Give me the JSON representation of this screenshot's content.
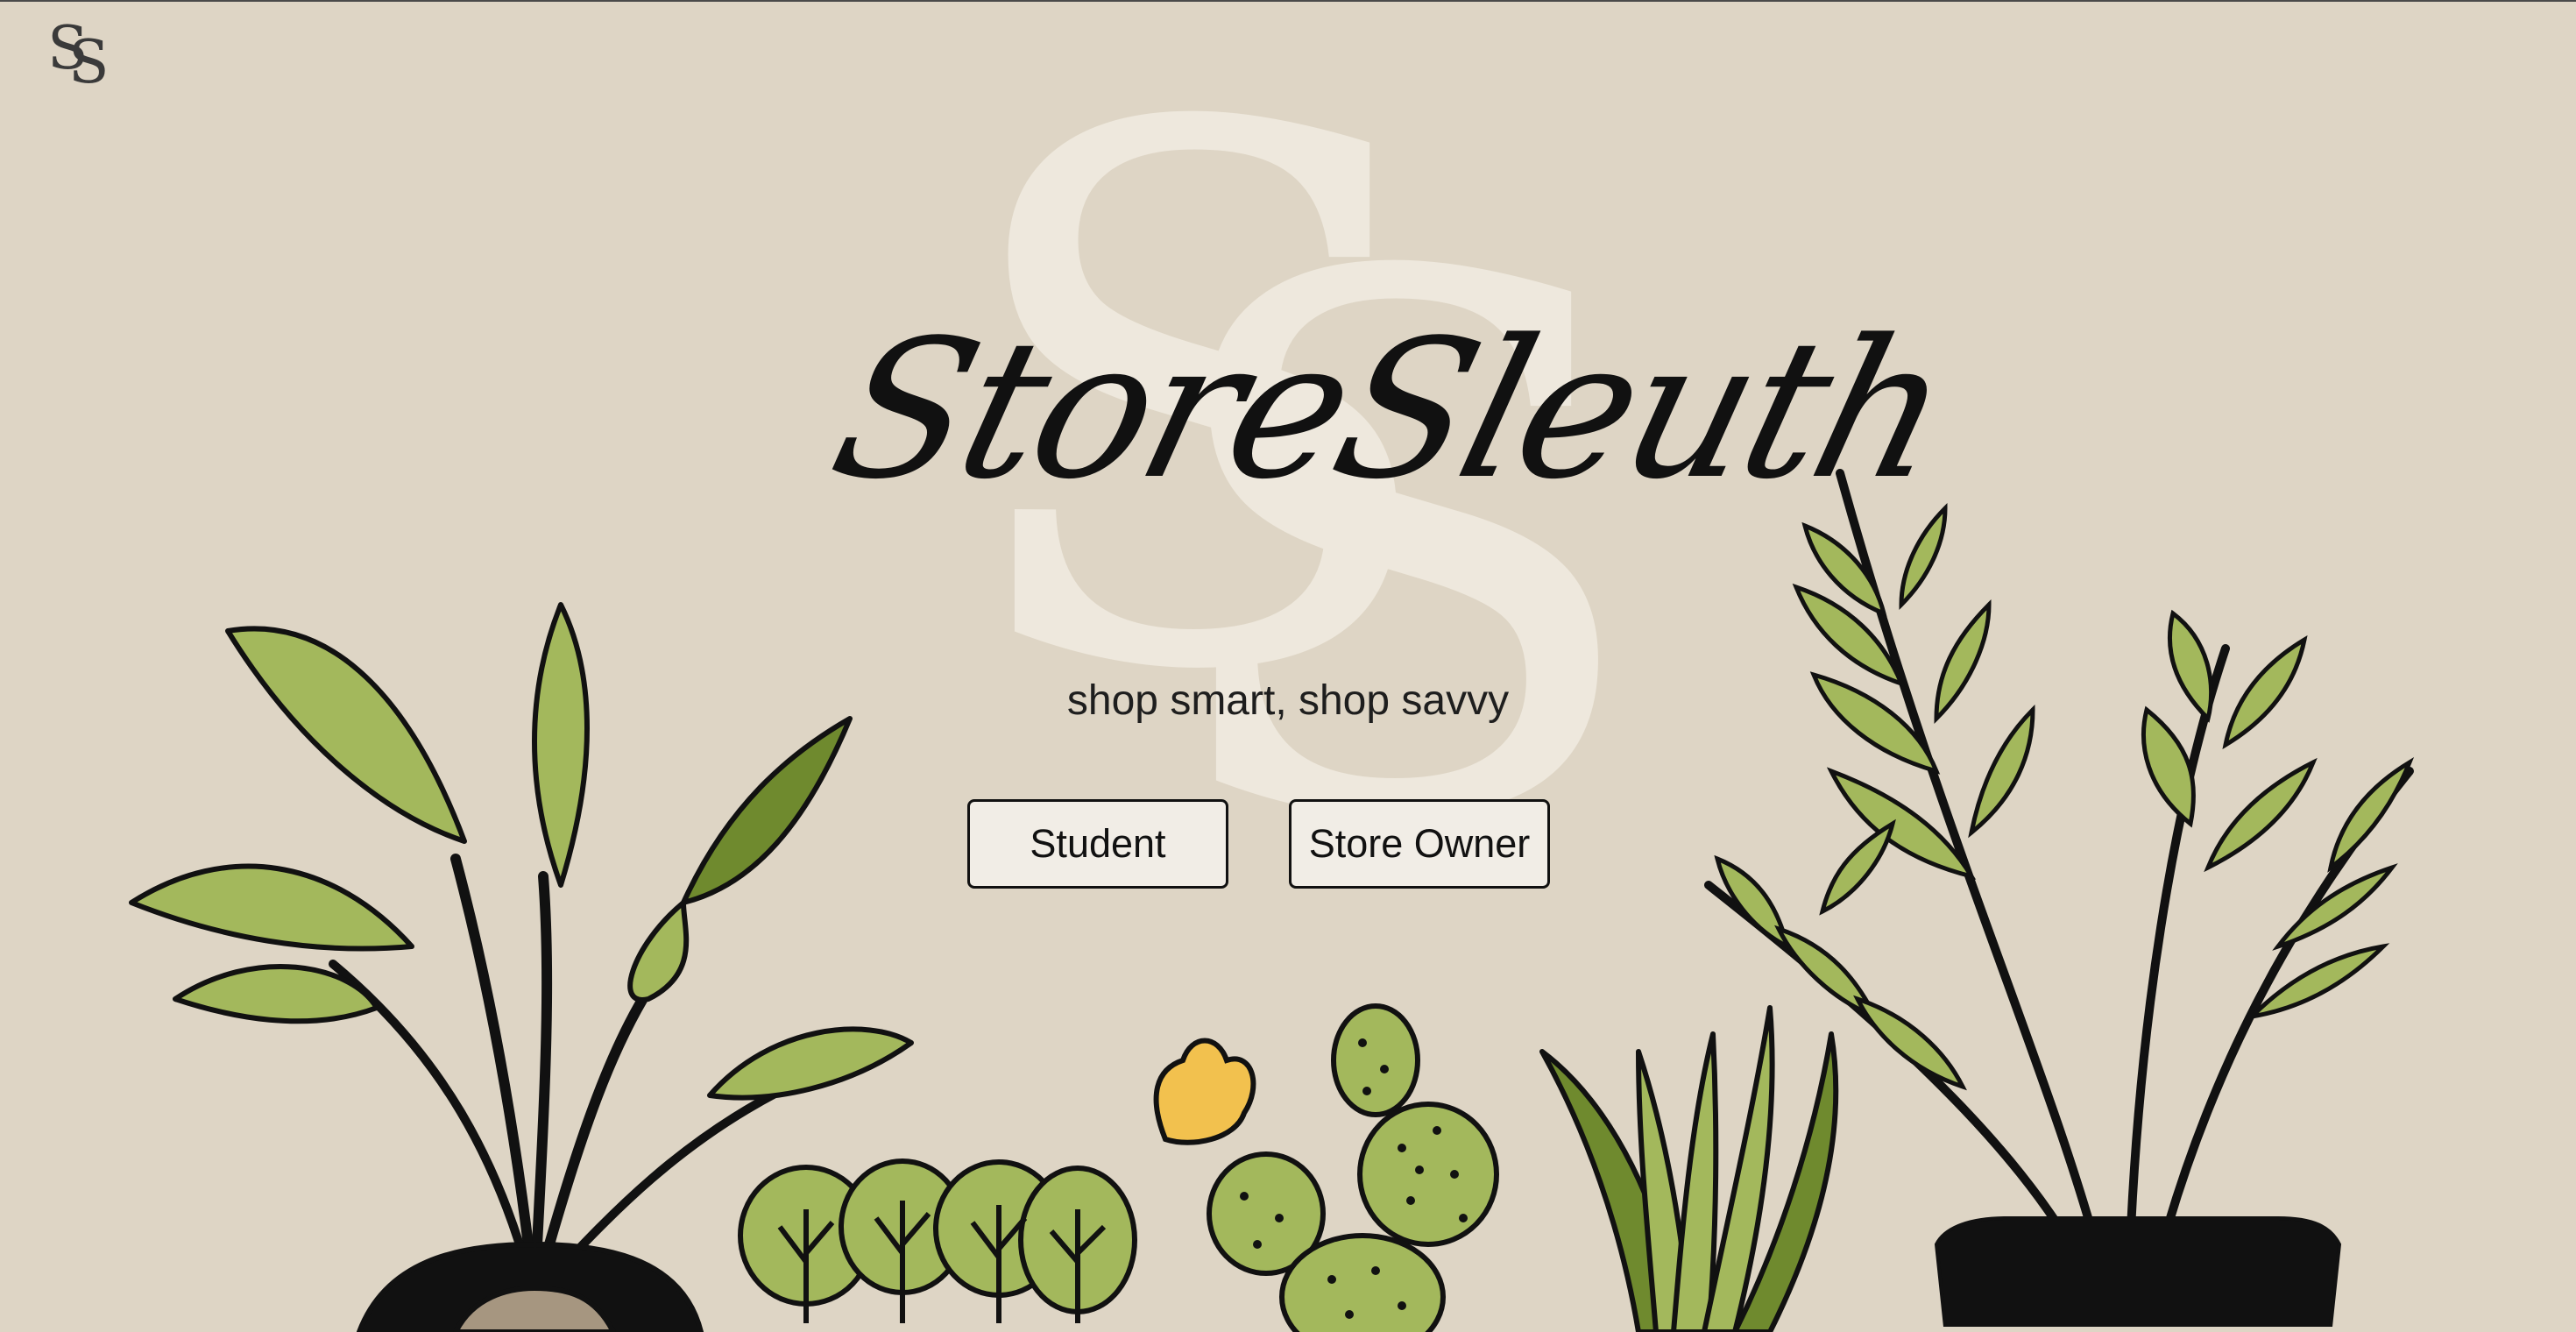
{
  "brand": {
    "logo_letters": [
      "S",
      "S"
    ],
    "watermark_letters": [
      "S",
      "S"
    ],
    "title": "StoreSleuth",
    "tagline": "shop smart, shop savvy"
  },
  "actions": {
    "student_label": "Student",
    "store_owner_label": "Store Owner"
  },
  "colors": {
    "background": "#ded5c5",
    "leaf_green": "#a3b85c",
    "dark_green": "#6f8a2e",
    "flower_yellow": "#f2c14e",
    "outline": "#111111",
    "button_fill": "#f1ede6"
  },
  "illustrations": [
    "banana-leaf-plant-icon",
    "leafy-herb-plant-icon",
    "flowering-cactus-icon",
    "aloe-plant-icon",
    "palm-fern-plant-icon"
  ]
}
